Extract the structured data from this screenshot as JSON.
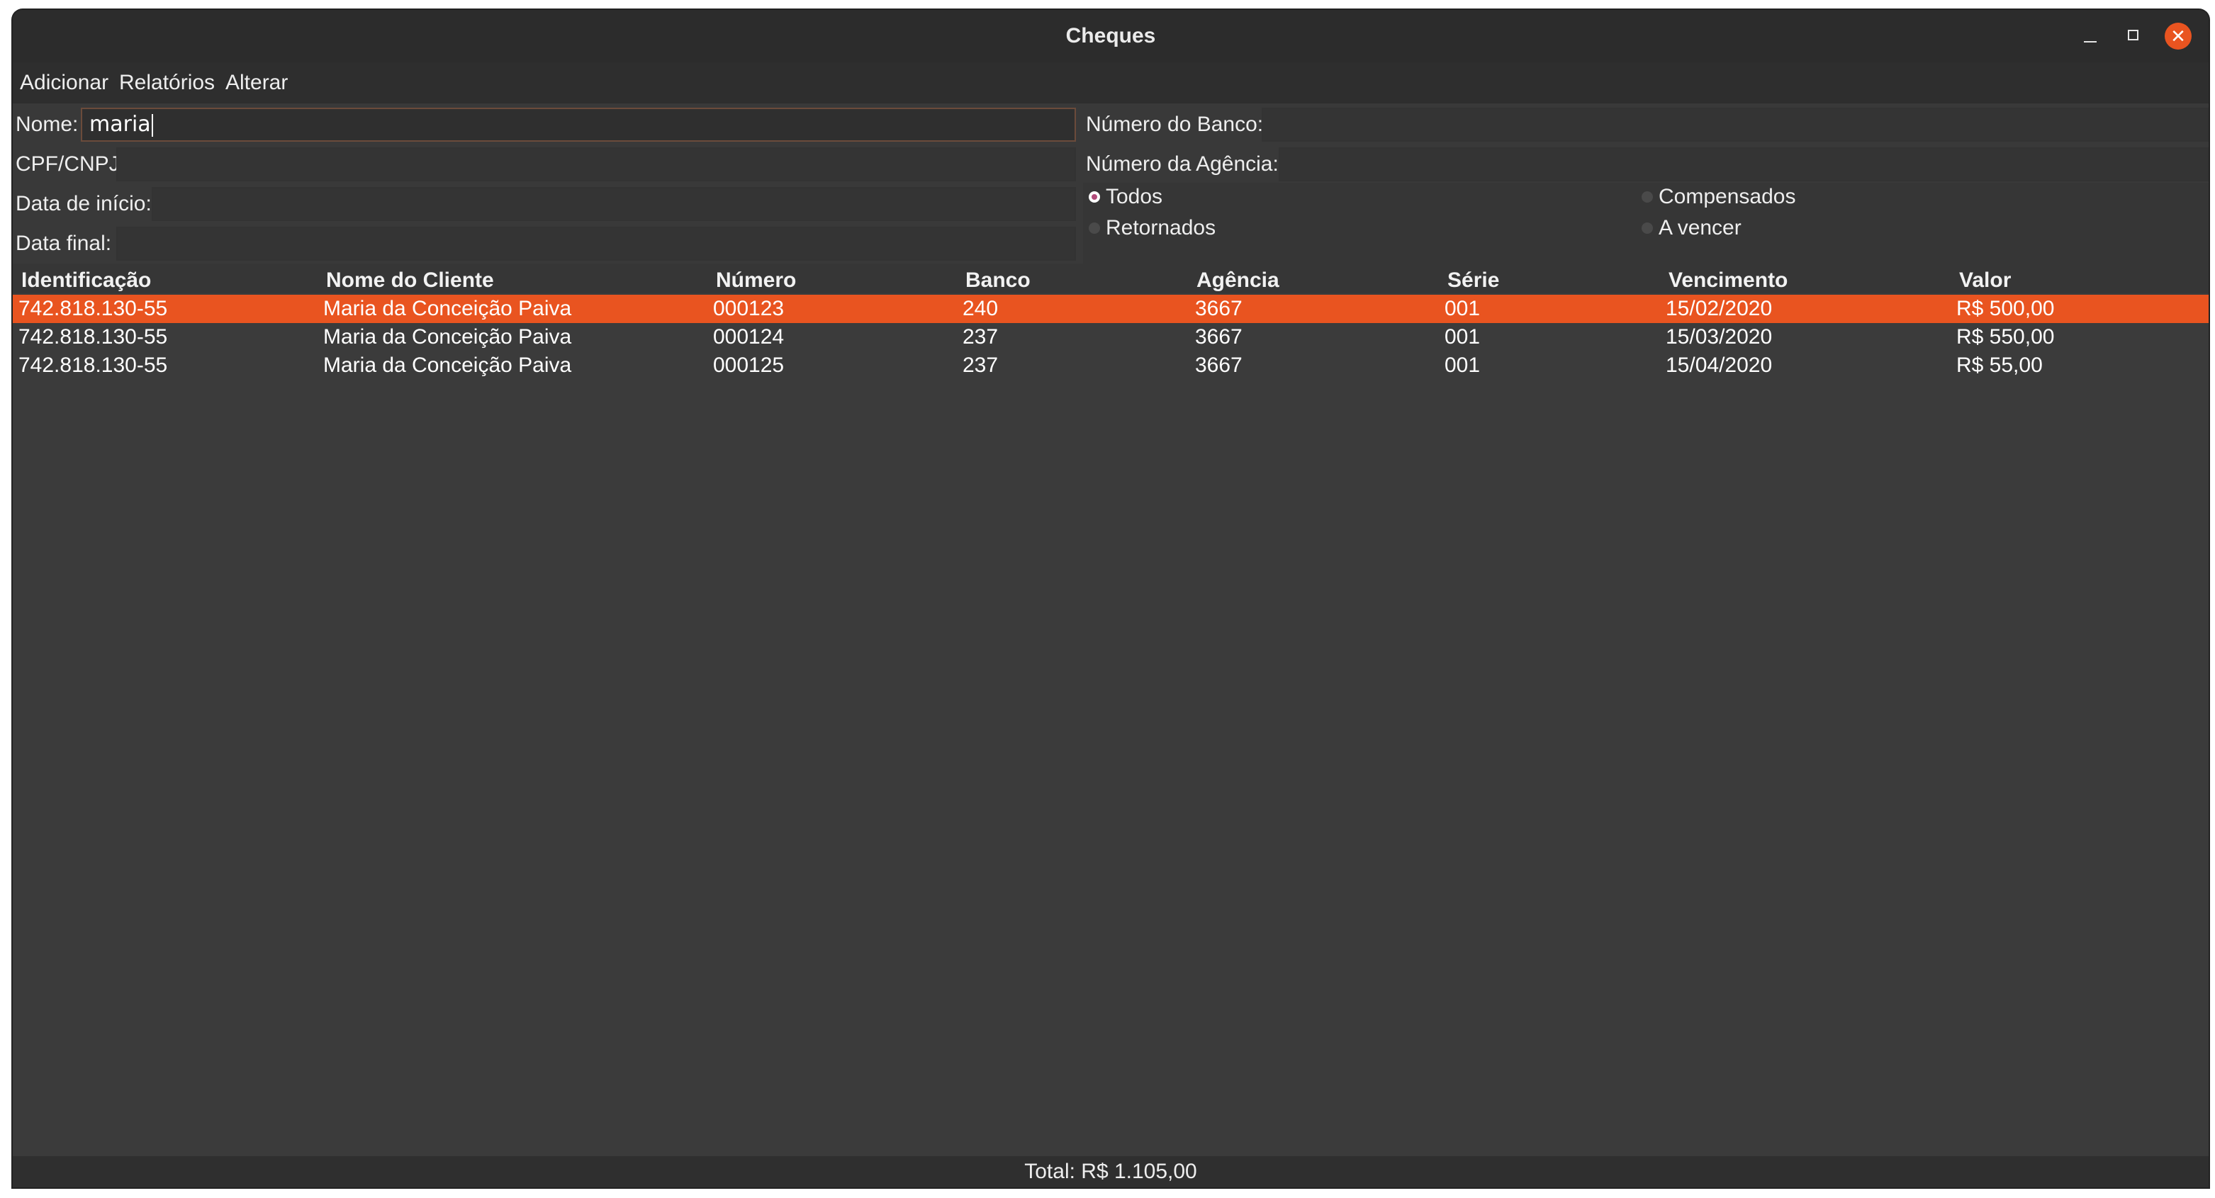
{
  "window": {
    "title": "Cheques"
  },
  "menu": {
    "items": [
      "Adicionar",
      "Relatórios",
      "Alterar"
    ]
  },
  "form": {
    "nome_label": "Nome:",
    "nome_value": "maria",
    "cpf_label": "CPF/CNPJ:",
    "cpf_value": "",
    "data_inicio_label": "Data de início:",
    "data_inicio_value": "",
    "data_final_label": "Data final:",
    "data_final_value": "",
    "numero_banco_label": "Número do Banco:",
    "numero_banco_value": "",
    "numero_agencia_label": "Número da Agência:",
    "numero_agencia_value": "",
    "filters": [
      {
        "label": "Todos",
        "selected": true
      },
      {
        "label": "Compensados",
        "selected": false
      },
      {
        "label": "Retornados",
        "selected": false
      },
      {
        "label": "A vencer",
        "selected": false
      }
    ]
  },
  "table": {
    "columns": [
      "Identificação",
      "Nome do Cliente",
      "Número",
      "Banco",
      "Agência",
      "Série",
      "Vencimento",
      "Valor"
    ],
    "rows": [
      {
        "selected": true,
        "cells": [
          "742.818.130-55",
          "Maria da Conceição Paiva",
          "000123",
          "240",
          "3667",
          "001",
          "15/02/2020",
          "R$ 500,00"
        ]
      },
      {
        "selected": false,
        "cells": [
          "742.818.130-55",
          "Maria da Conceição Paiva",
          "000124",
          "237",
          "3667",
          "001",
          "15/03/2020",
          "R$ 550,00"
        ]
      },
      {
        "selected": false,
        "cells": [
          "742.818.130-55",
          "Maria da Conceição Paiva",
          "000125",
          "237",
          "3667",
          "001",
          "15/04/2020",
          "R$ 55,00"
        ]
      }
    ]
  },
  "footer": {
    "total": "Total: R$ 1.105,00"
  },
  "colors": {
    "accent": "#e95420",
    "background": "#393939",
    "titlebar": "#2c2c2c"
  },
  "icons": {
    "minimize": "minimize-icon",
    "maximize": "maximize-icon",
    "close": "close-icon"
  }
}
